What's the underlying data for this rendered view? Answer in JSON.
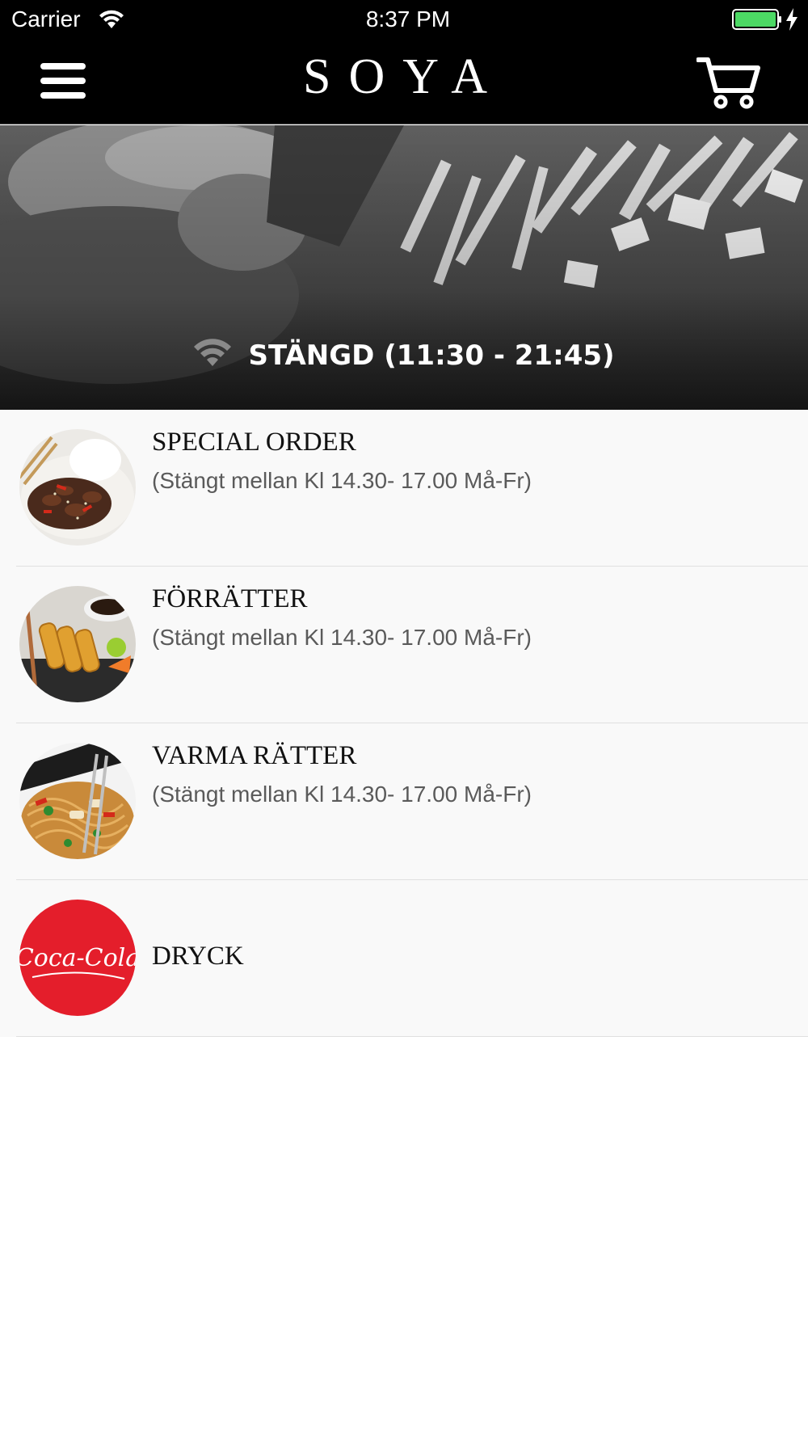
{
  "status_bar": {
    "carrier": "Carrier",
    "time": "8:37 PM",
    "icons": [
      "wifi-icon",
      "battery-icon",
      "charging-bolt-icon"
    ],
    "battery_color": "#4cd964"
  },
  "navbar": {
    "logo": "SOYA",
    "icons": [
      "hamburger-menu-icon",
      "cart-icon"
    ],
    "background": "#000000"
  },
  "hero": {
    "status_text": "STÄNGD (11:30 - 21:45)",
    "icon": "wifi-icon"
  },
  "categories": [
    {
      "title": "SPECIAL ORDER",
      "subtitle": "(Stängt mellan Kl 14.30- 17.00 Må-Fr)",
      "image": "beef-dish-photo"
    },
    {
      "title": "FÖRRÄTTER",
      "subtitle": "(Stängt mellan Kl 14.30- 17.00 Må-Fr)",
      "image": "spring-rolls-photo"
    },
    {
      "title": "VARMA RÄTTER",
      "subtitle": "(Stängt mellan Kl 14.30- 17.00 Må-Fr)",
      "image": "noodles-photo"
    },
    {
      "title": "DRYCK",
      "subtitle": "",
      "image": "coca-cola-logo",
      "image_text": "Coca-Cola",
      "accent": "#e41e2b"
    }
  ]
}
